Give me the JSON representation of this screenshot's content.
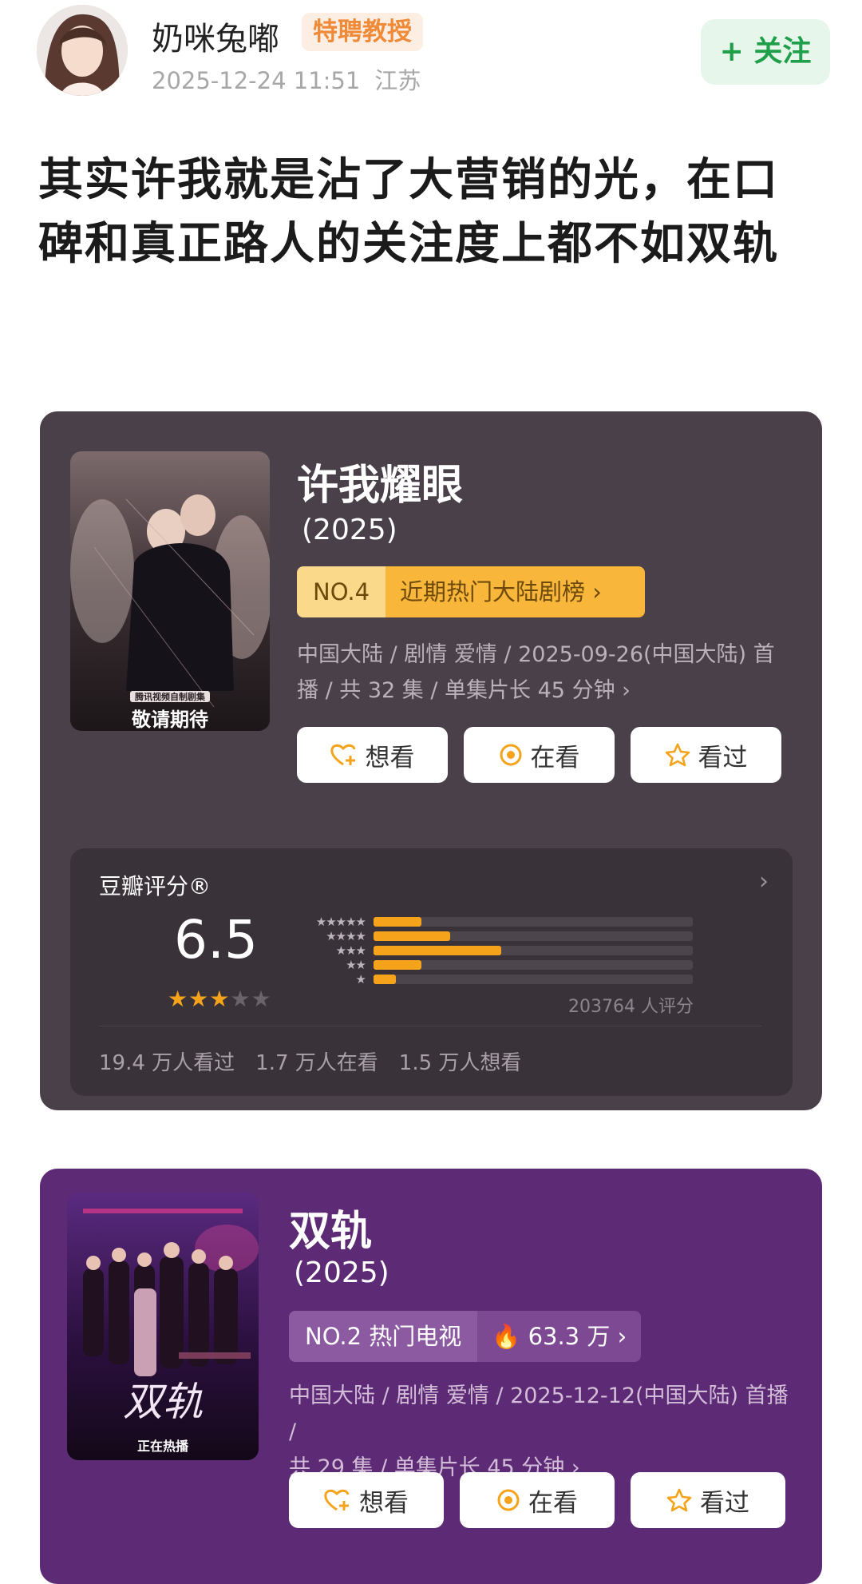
{
  "post": {
    "username": "奶咪兔嘟",
    "badge": "特聘教授",
    "timestamp": "2025-12-24 11:51",
    "location": "江苏",
    "follow_label": "+ 关注",
    "text": "其实许我就是沾了大营销的光，在口碑和真正路人的关注度上都不如双轨"
  },
  "cards": [
    {
      "title": "许我耀眼",
      "year": "(2025)",
      "rank_no": "NO.4",
      "rank_text": "近期热门大陆剧榜",
      "info_line1": "中国大陆 / 剧情 爱情 / 2025-09-26(中国大陆) 首",
      "info_line2": "播 / 共 32 集 / 单集片长 45 分钟",
      "poster_caption": "敬请期待",
      "poster_sub": "腾讯视频自制剧集",
      "buttons": [
        "想看",
        "在看",
        "看过"
      ],
      "rating": {
        "label": "豆瓣评分®",
        "score": "6.5",
        "stars": 3,
        "count_text": "203764 人评分",
        "distribution": [
          0.15,
          0.24,
          0.4,
          0.15,
          0.07
        ],
        "stats": [
          "19.4 万人看过",
          "1.7 万人在看",
          "1.5 万人想看"
        ]
      }
    },
    {
      "title": "双轨",
      "year": "(2025)",
      "rank_no": "NO.2 热门电视",
      "rank_text": "63.3 万",
      "info_line1": "中国大陆 / 剧情 爱情 / 2025-12-12(中国大陆) 首播 /",
      "info_line2": "共 29 集 / 单集片长 45 分钟",
      "poster_caption": "正在热播",
      "poster_title": "双轨",
      "buttons": [
        "想看",
        "在看",
        "看过"
      ]
    }
  ],
  "colors": {
    "card1_bg": "#4a4049",
    "card2_bg": "#5d2a75",
    "accent_orange": "#f5a31a",
    "follow_green": "#1f9f4a"
  }
}
